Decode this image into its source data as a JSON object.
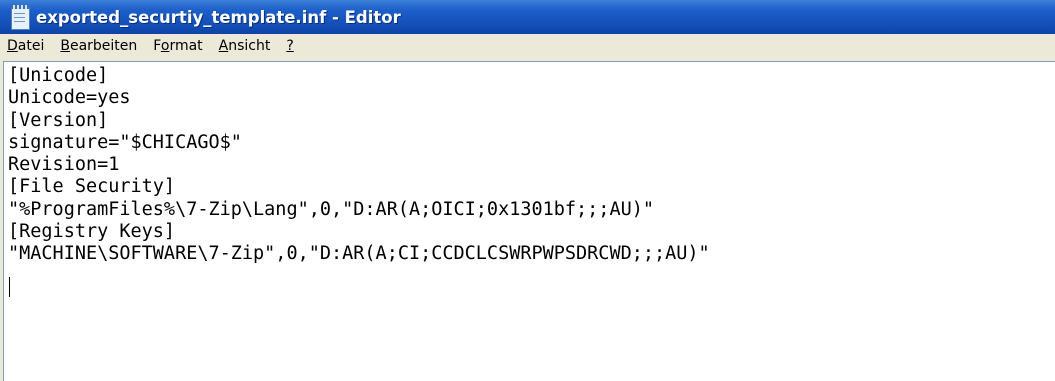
{
  "window": {
    "title": "exported_securtiy_template.inf - Editor",
    "icon": "notepad-icon"
  },
  "menu": {
    "items": [
      {
        "mnemonic": "D",
        "rest": "atei"
      },
      {
        "mnemonic": "B",
        "rest": "earbeiten"
      },
      {
        "pre": "F",
        "mnemonic": "o",
        "rest": "rmat"
      },
      {
        "mnemonic": "A",
        "rest": "nsicht"
      },
      {
        "mnemonic": "?",
        "rest": ""
      }
    ]
  },
  "editor": {
    "lines": [
      "[Unicode]",
      "Unicode=yes",
      "[Version]",
      "signature=\"$CHICAGO$\"",
      "Revision=1",
      "[File Security]",
      "\"%ProgramFiles%\\7-Zip\\Lang\",0,\"D:AR(A;OICI;0x1301bf;;;AU)\"",
      "[Registry Keys]",
      "\"MACHINE\\SOFTWARE\\7-Zip\",0,\"D:AR(A;CI;CCDCLCSWRPWPSDRCWD;;;AU)\""
    ]
  }
}
